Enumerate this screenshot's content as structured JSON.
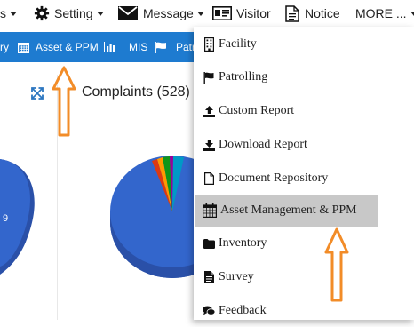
{
  "topbar": {
    "item0": "s",
    "setting": "Setting",
    "message": "Message",
    "visitor": "Visitor",
    "notice": "Notice",
    "more": "MORE ..."
  },
  "bluebar": {
    "item0": "ry",
    "asset": "Asset & PPM",
    "mis": "MIS",
    "patrol": "Patr"
  },
  "panel": {
    "title": "Complaints (528)",
    "left_value": "9"
  },
  "dropdown": {
    "items": [
      {
        "label": "Facility",
        "icon": "building-icon"
      },
      {
        "label": "Patrolling",
        "icon": "flag-icon"
      },
      {
        "label": "Custom Report",
        "icon": "upload-icon"
      },
      {
        "label": "Download Report",
        "icon": "download-icon"
      },
      {
        "label": "Document Repository",
        "icon": "file-icon"
      },
      {
        "label": "Asset Management & PPM",
        "icon": "calendar-icon"
      },
      {
        "label": "Inventory",
        "icon": "folder-icon"
      },
      {
        "label": "Survey",
        "icon": "file-text-icon"
      },
      {
        "label": "Feedback",
        "icon": "comments-icon"
      }
    ],
    "active_index": 5
  },
  "colors": {
    "bluebar": "#1e7bd0",
    "arrow": "#f28c28",
    "active_item": "#c8c8c8",
    "pie_main": "#3366cc",
    "pie_side": "#2a50a8"
  }
}
